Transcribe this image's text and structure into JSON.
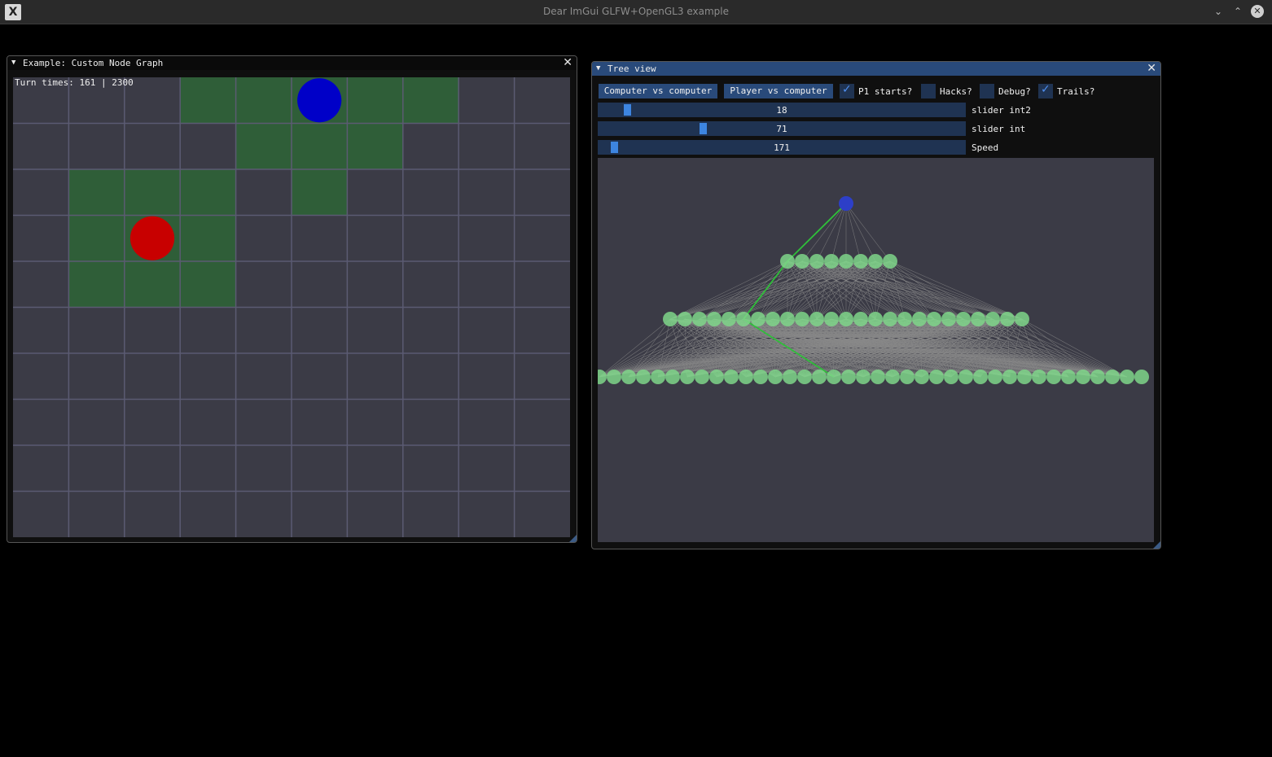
{
  "os_window": {
    "title": "Dear ImGui GLFW+OpenGL3 example",
    "app_icon": "X",
    "controls": {
      "minimize": "⌄",
      "maximize": "⌃",
      "close": "✕"
    }
  },
  "node_graph_window": {
    "title": "Example: Custom Node Graph",
    "collapse_glyph": "▼",
    "close_glyph": "✕",
    "turn_times": "Turn times: 161 | 2300",
    "board": {
      "cols": 10,
      "rows": 10,
      "highlighted_cells": [
        [
          3,
          0
        ],
        [
          4,
          0
        ],
        [
          5,
          0
        ],
        [
          6,
          0
        ],
        [
          7,
          0
        ],
        [
          4,
          1
        ],
        [
          5,
          1
        ],
        [
          6,
          1
        ],
        [
          1,
          2
        ],
        [
          2,
          2
        ],
        [
          3,
          2
        ],
        [
          5,
          2
        ],
        [
          1,
          3
        ],
        [
          2,
          3
        ],
        [
          3,
          3
        ],
        [
          1,
          4
        ],
        [
          2,
          4
        ],
        [
          3,
          4
        ]
      ],
      "pieces": [
        {
          "name": "blue-piece",
          "col": 5.5,
          "row": 0.5,
          "color": "#0000c8"
        },
        {
          "name": "red-piece",
          "col": 2.5,
          "row": 3.5,
          "color": "#c80000"
        }
      ],
      "colors": {
        "background": "#3b3b46",
        "highlight": "#2f5e38",
        "gridline": "#5b5b72"
      }
    }
  },
  "tree_window": {
    "title": "Tree view",
    "collapse_glyph": "▼",
    "close_glyph": "✕",
    "buttons": {
      "computer_vs_computer": "Computer vs computer",
      "player_vs_computer": "Player vs computer"
    },
    "checkboxes": [
      {
        "label": "P1 starts?",
        "checked": true
      },
      {
        "label": "Hacks?",
        "checked": false
      },
      {
        "label": "Debug?",
        "checked": false
      },
      {
        "label": "Trails?",
        "checked": true
      }
    ],
    "checkmark_glyph": "✓",
    "sliders": [
      {
        "label": "slider int2",
        "value": "18",
        "fraction": 0.08
      },
      {
        "label": "slider int",
        "value": "71",
        "fraction": 0.28
      },
      {
        "label": "Speed",
        "value": "171",
        "fraction": 0.04
      }
    ],
    "tree": {
      "root_color": "#2d3fc8",
      "node_color": "#7fd68a",
      "edge_color": "#8a8a8a",
      "path_color": "#2fbf3a",
      "level_counts": [
        1,
        8,
        25,
        38
      ],
      "highlight_path": [
        0,
        0,
        5,
        16
      ]
    }
  },
  "colors": {
    "title_active": "#294a7a",
    "title_inactive": "#0a0a0a",
    "button": "#294a7a",
    "frame": "#1f3352",
    "accent": "#4f8ff0"
  }
}
